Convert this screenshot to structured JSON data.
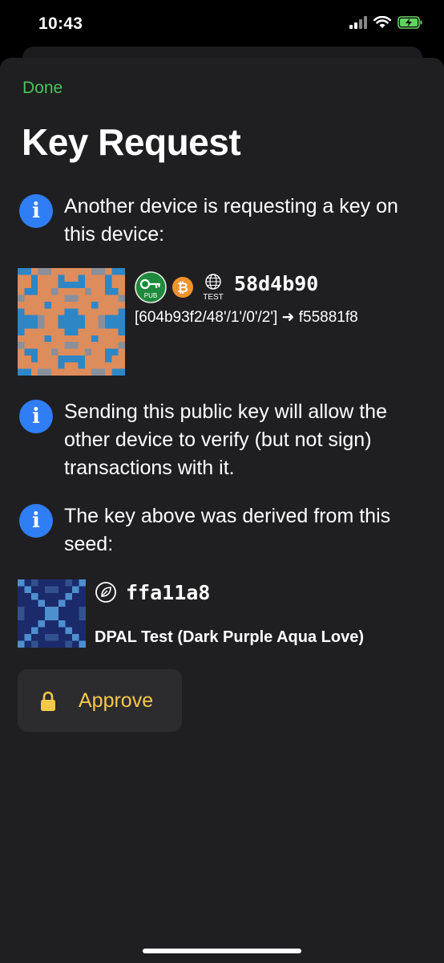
{
  "status": {
    "time": "10:43",
    "icons": [
      "signal-icon",
      "wifi-icon",
      "battery-charging-icon"
    ]
  },
  "nav": {
    "done_label": "Done"
  },
  "page": {
    "title": "Key Request"
  },
  "info": [
    {
      "icon": "info-icon",
      "text": "Another device is requesting a key on this device:"
    },
    {
      "icon": "info-icon",
      "text": "Sending this public key will allow the other device to verify (but not sign) transactions with it."
    },
    {
      "icon": "info-icon",
      "text": "The key above was derived from this seed:"
    }
  ],
  "key": {
    "badge_pub": "PUB",
    "badge_test": "TEST",
    "fingerprint": "58d4b90",
    "path": "[604b93f2/48'/1'/0'/2'] ➜ f55881f8",
    "icons": [
      "public-key-icon",
      "bitcoin-icon",
      "testnet-globe-icon"
    ]
  },
  "seed": {
    "fingerprint": "ffa11a8",
    "name": "DPAL Test (Dark Purple Aqua Love)",
    "icon": "seed-leaf-icon"
  },
  "approve": {
    "label": "Approve",
    "icon": "lock-icon"
  },
  "colors": {
    "accent_green": "#4cc35d",
    "info_blue": "#2f7ef6",
    "approve_yellow": "#f5c84b",
    "sheet_bg": "#1f1f21",
    "button_bg": "#2c2c2e"
  }
}
